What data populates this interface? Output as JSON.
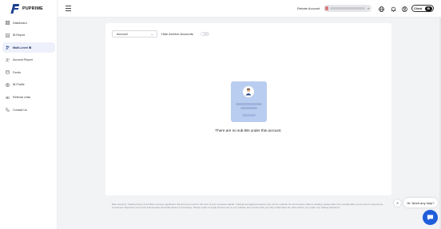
{
  "brand": {
    "name": "PUPRIME"
  },
  "sidebar": {
    "items": [
      {
        "label": "Dashboard",
        "icon": "grid-icon",
        "active": false
      },
      {
        "label": "IB Report",
        "icon": "report-icon",
        "active": false
      },
      {
        "label": "Multi-Level IB",
        "icon": "users-icon",
        "active": true
      },
      {
        "label": "Account Report",
        "icon": "account-report-icon",
        "active": false
      },
      {
        "label": "Funds",
        "icon": "funds-icon",
        "active": false
      },
      {
        "label": "IB Profile",
        "icon": "profile-icon",
        "active": false
      },
      {
        "label": "Referral Links",
        "icon": "link-icon",
        "active": false
      },
      {
        "label": "Contact Us",
        "icon": "contact-icon",
        "active": false
      }
    ]
  },
  "header": {
    "rebate_label": "Rebate Account",
    "client_toggle": {
      "label": "Client",
      "active": "IB"
    }
  },
  "main": {
    "filter_select": "Account",
    "archive_label": "Hide Archive Accounts",
    "archive_on": false,
    "empty_message": "There are no sub-IBs under this account."
  },
  "disclaimer": "Risk warning: Trading Forex and CFDs involves significant risk and can result in the loss of your invested capital. Trading leveraged products may not be suitable for all investors. Before trading, please take into consideration your level of experience, investment objectives and seek independent financial advice if necessary. Please read our legal documents on our website and ensure that you fully understand the risks before you make any trading decisions.",
  "help": {
    "bubble_text": "Hi. Need any help?"
  },
  "colors": {
    "accent": "#1b3f8f",
    "chat": "#1f5ed9",
    "tile": "#b9cdf0"
  }
}
